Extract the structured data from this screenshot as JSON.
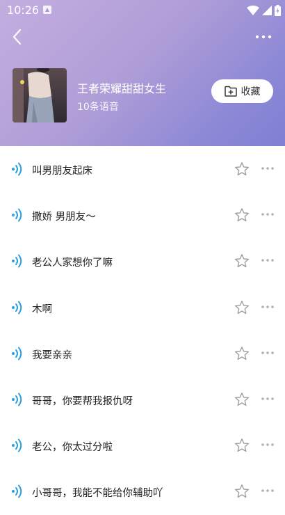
{
  "status": {
    "time": "10:26"
  },
  "header": {
    "album_title": "王者荣耀甜甜女生",
    "album_count": "10条语音",
    "collect_label": "收藏"
  },
  "items": [
    {
      "label": "叫男朋友起床"
    },
    {
      "label": "撒娇 男朋友～"
    },
    {
      "label": "老公人家想你了嘛"
    },
    {
      "label": "木啊"
    },
    {
      "label": "我要亲亲"
    },
    {
      "label": "哥哥，你要帮我报仇呀"
    },
    {
      "label": "老公，你太过分啦"
    },
    {
      "label": "小哥哥，我能不能给你辅助吖"
    }
  ],
  "colors": {
    "accent_wave": "#2a9fe0",
    "header_gradient_start": "#c3aedf",
    "header_gradient_end": "#7f7fd3",
    "star_outline": "#9e9e9e",
    "dots": "#b0b0b0"
  },
  "icons": {
    "back": "chevron-left-icon",
    "more": "more-horizontal-icon",
    "collect": "folder-plus-icon",
    "play": "sound-wave-icon",
    "favorite": "star-outline-icon",
    "row_more": "more-horizontal-icon"
  }
}
